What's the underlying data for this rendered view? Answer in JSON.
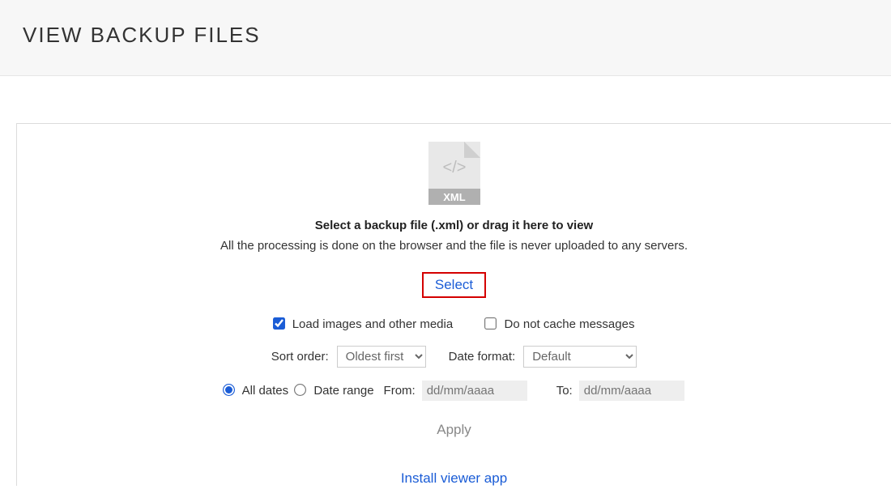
{
  "header": {
    "title": "VIEW BACKUP FILES"
  },
  "drop": {
    "icon_name": "xml-file-icon",
    "prompt_bold": "Select a backup file (.xml) or drag it here to view",
    "prompt_sub": "All the processing is done on the browser and the file is never uploaded to any servers.",
    "select_label": "Select"
  },
  "options": {
    "load_images": {
      "label": "Load images and other media",
      "checked": true
    },
    "no_cache": {
      "label": "Do not cache messages",
      "checked": false
    }
  },
  "sort": {
    "label": "Sort order:",
    "selected": "Oldest first",
    "options": [
      "Oldest first"
    ]
  },
  "date_format": {
    "label": "Date format:",
    "selected": "Default",
    "options": [
      "Default"
    ]
  },
  "dates": {
    "all_label": "All dates",
    "range_label": "Date range",
    "selected": "all",
    "from_label": "From:",
    "to_label": "To:",
    "from_placeholder": "dd/mm/aaaa",
    "to_placeholder": "dd/mm/aaaa"
  },
  "apply_label": "Apply",
  "install_link": "Install viewer app"
}
